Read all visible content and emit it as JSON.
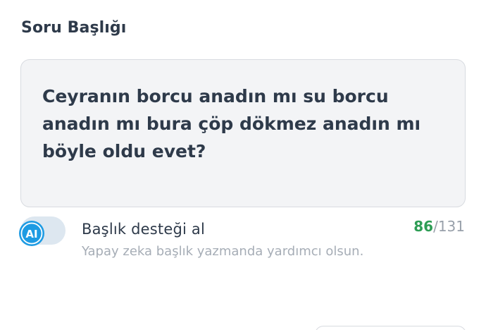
{
  "section": {
    "title": "Soru Başlığı"
  },
  "question": {
    "value": "Ceyranın borcu anadın mı su borcu\nanadın mı bura çöp dökmez anadın mı\nböyle oldu evet?"
  },
  "ai_help": {
    "icon_label": "AI",
    "title": "Başlık desteği al",
    "subtitle": "Yapay zeka başlık yazmanda yardımcı olsun.",
    "enabled": false
  },
  "counter": {
    "current": "86",
    "separator": "/",
    "max": "131"
  },
  "colors": {
    "text_primary": "#2e3a4a",
    "text_muted": "#a6adb6",
    "counter_ok": "#2e9d55",
    "ai_accent": "#1e9be3",
    "field_bg": "#f3f4f6"
  }
}
